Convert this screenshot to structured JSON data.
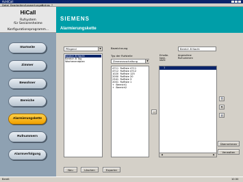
{
  "window": {
    "title": "AcHiCall"
  },
  "menu": [
    "Datei",
    "Bearbeiten",
    "Auswertungen",
    "Extras",
    "?"
  ],
  "app": {
    "name": "HiCall",
    "subtitle1": "Rufsystem",
    "subtitle2": "für Seniorenheime",
    "mode": "Konfigurationsprogramm..."
  },
  "header": {
    "brand": "SIEMENS",
    "page_title": "Alarmierungskette"
  },
  "nav": [
    {
      "label": "Startseite",
      "active": false
    },
    {
      "label": "Zimmer",
      "active": false
    },
    {
      "label": "Bewohner",
      "active": false
    },
    {
      "label": "Bereiche",
      "active": false
    },
    {
      "label": "Alarmierungskette",
      "active": true
    },
    {
      "label": "Rufnummern",
      "active": false
    },
    {
      "label": "Alarmverfolgung",
      "active": false
    }
  ],
  "filter": {
    "value": "Pflegend"
  },
  "chains": {
    "items": [
      "Bereich B Nacht",
      "Bereich B Tag",
      "Wochenendplan"
    ],
    "selected": 0
  },
  "form": {
    "label_name": "Bezeichnung",
    "name_value": "Bereich B Nacht",
    "label_type": "Typ der Rufstelle",
    "type_value": "Zimmerzuschaltung"
  },
  "sources": [
    {
      "num": "4711",
      "name": "Rufliste 4711"
    },
    {
      "num": "4712",
      "name": "Rufliste 4712"
    },
    {
      "num": "1020",
      "name": "Rufliste 125"
    },
    {
      "num": "2000",
      "name": "Rufliste 20"
    },
    {
      "num": "2341",
      "name": "Rufliste 3"
    },
    {
      "num": "2001",
      "name": "Rufliste 1"
    },
    {
      "num": "+",
      "name": "Bereich1"
    },
    {
      "num": "+",
      "name": "Bereich2"
    }
  ],
  "chain_columns": {
    "col1": "Erhalte-\nkann-\nstufe",
    "col2": "Angerufene\nRufnummern"
  },
  "chain_rows": [
    {
      "level": "1",
      "numbers": ""
    }
  ],
  "buttons": {
    "add": "...",
    "up": "↑",
    "delete": "✕",
    "down": "↓",
    "details": "Übernehmen",
    "overview": "Verwalten",
    "new": "Neu",
    "delete_chain": "Löschen",
    "export": "Exporter"
  },
  "status": {
    "left": "Bereit",
    "right": "10:30"
  }
}
